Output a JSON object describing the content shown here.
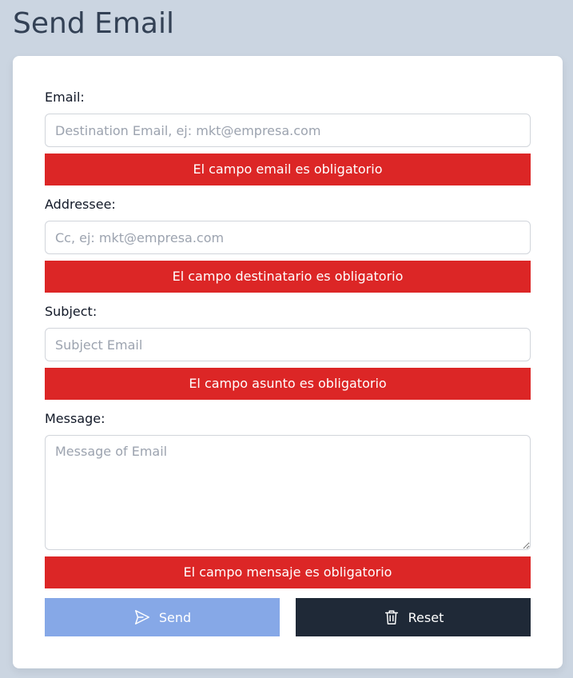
{
  "page": {
    "title": "Send Email"
  },
  "form": {
    "email": {
      "label": "Email:",
      "placeholder": "Destination Email, ej: mkt@empresa.com",
      "value": "",
      "error": "El campo email es obligatorio"
    },
    "addressee": {
      "label": "Addressee:",
      "placeholder": "Cc, ej: mkt@empresa.com",
      "value": "",
      "error": "El campo destinatario es obligatorio"
    },
    "subject": {
      "label": "Subject:",
      "placeholder": "Subject Email",
      "value": "",
      "error": "El campo asunto es obligatorio"
    },
    "message": {
      "label": "Message:",
      "placeholder": "Message of Email",
      "value": "",
      "error": "El campo mensaje es obligatorio"
    }
  },
  "buttons": {
    "send_label": "Send",
    "send_icon": "paper-plane-icon",
    "reset_label": "Reset",
    "reset_icon": "trash-icon"
  },
  "colors": {
    "background": "#cbd5e1",
    "error": "#dc2626",
    "send_button": "#86a8e7",
    "reset_button": "#1f2937"
  }
}
